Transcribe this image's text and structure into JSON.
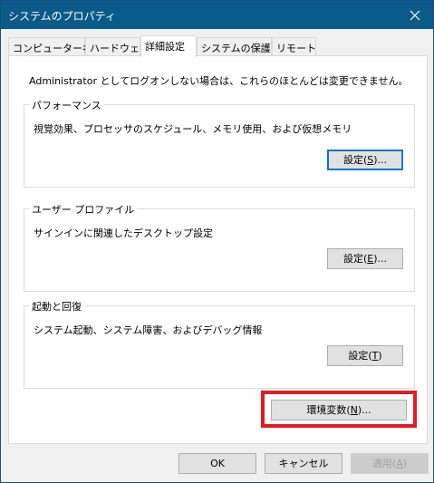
{
  "window": {
    "title": "システムのプロパティ",
    "close_glyph": "✕"
  },
  "tabs": [
    {
      "label": "コンピューター名"
    },
    {
      "label": "ハードウェア"
    },
    {
      "label": "詳細設定"
    },
    {
      "label": "システムの保護"
    },
    {
      "label": "リモート"
    }
  ],
  "active_tab": "詳細設定",
  "admin_note": "Administrator としてログオンしない場合は、これらのほとんどは変更できません。",
  "performance": {
    "title": "パフォーマンス",
    "description": "視覚効果、プロセッサのスケジュール、メモリ使用、および仮想メモリ",
    "button_prefix": "設定(",
    "button_key": "S",
    "button_suffix": ")..."
  },
  "user_profile": {
    "title": "ユーザー プロファイル",
    "description": "サインインに関連したデスクトップ設定",
    "button_prefix": "設定(",
    "button_key": "E",
    "button_suffix": ")..."
  },
  "startup_recovery": {
    "title": "起動と回復",
    "description": "システム起動、システム障害、およびデバッグ情報",
    "button_prefix": "設定(",
    "button_key": "T",
    "button_suffix": ")"
  },
  "env_vars": {
    "button_prefix": "環境変数(",
    "button_key": "N",
    "button_suffix": ")...",
    "highlight_color": "#e21b23"
  },
  "footer": {
    "ok_label": "OK",
    "cancel_label": "キャンセル",
    "apply_prefix": "適用(",
    "apply_key": "A",
    "apply_suffix": ")"
  },
  "colors": {
    "titlebar": "#0a5a8a",
    "focus_border": "#0078d7",
    "highlight": "#e21b23"
  },
  "icons": [
    "close-icon"
  ]
}
